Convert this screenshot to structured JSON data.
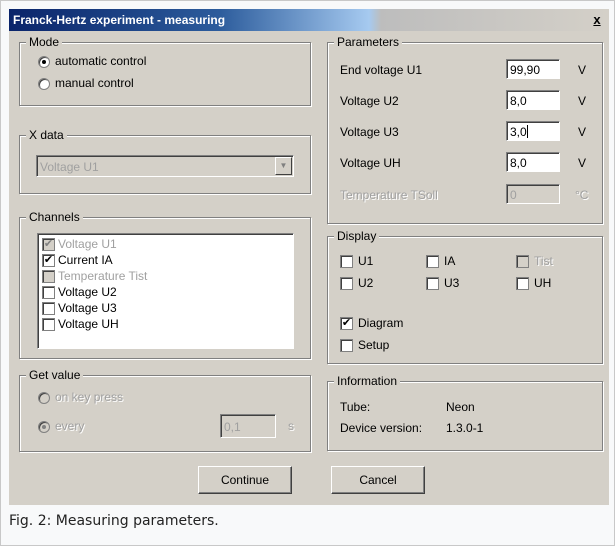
{
  "window": {
    "title": "Franck-Hertz experiment - measuring",
    "close": "x"
  },
  "mode": {
    "legend": "Mode",
    "options": [
      {
        "label": "automatic control",
        "selected": true
      },
      {
        "label": "manual control",
        "selected": false
      }
    ]
  },
  "xdata": {
    "legend": "X data",
    "selected": "Voltage U1",
    "enabled": false
  },
  "channels": {
    "legend": "Channels",
    "items": [
      {
        "label": "Voltage U1",
        "checked": true,
        "enabled": false
      },
      {
        "label": "Current IA",
        "checked": true,
        "enabled": true
      },
      {
        "label": "Temperature Tist",
        "checked": false,
        "enabled": false
      },
      {
        "label": "Voltage U2",
        "checked": false,
        "enabled": true
      },
      {
        "label": "Voltage U3",
        "checked": false,
        "enabled": true
      },
      {
        "label": "Voltage UH",
        "checked": false,
        "enabled": true
      }
    ]
  },
  "getvalue": {
    "legend": "Get value",
    "options": [
      {
        "label": "on key press",
        "selected": false
      },
      {
        "label": "every",
        "selected": true
      }
    ],
    "interval": "0,1",
    "unit": "s"
  },
  "parameters": {
    "legend": "Parameters",
    "rows": [
      {
        "label": "End voltage U1",
        "value": "99,90",
        "unit": "V"
      },
      {
        "label": "Voltage U2",
        "value": "8,0",
        "unit": "V"
      },
      {
        "label": "Voltage U3",
        "value": "3,0",
        "unit": "V"
      },
      {
        "label": "Voltage UH",
        "value": "8,0",
        "unit": "V"
      },
      {
        "label": "Temperature TSoll",
        "value": "0",
        "unit": "°C"
      }
    ]
  },
  "display": {
    "legend": "Display",
    "checks": [
      {
        "label": "U1",
        "checked": false
      },
      {
        "label": "IA",
        "checked": false
      },
      {
        "label": "Tist",
        "checked": false
      },
      {
        "label": "U2",
        "checked": false
      },
      {
        "label": "U3",
        "checked": false
      },
      {
        "label": "UH",
        "checked": false
      },
      {
        "label": "Diagram",
        "checked": true
      },
      {
        "label": "Setup",
        "checked": false
      }
    ]
  },
  "information": {
    "legend": "Information",
    "tube_label": "Tube:",
    "tube_value": "Neon",
    "device_label": "Device version:",
    "device_value": "1.3.0-1"
  },
  "buttons": {
    "continue": "Continue",
    "cancel": "Cancel"
  },
  "caption": "Fig. 2: Measuring parameters."
}
